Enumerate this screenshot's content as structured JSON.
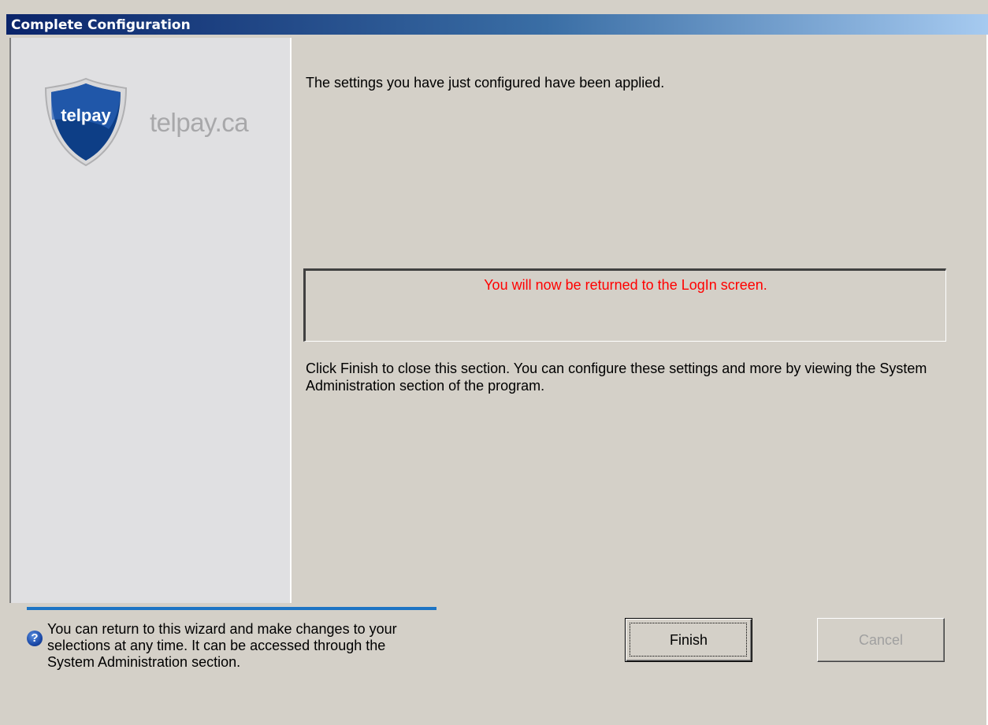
{
  "window": {
    "title": "Complete Configuration"
  },
  "sidebar": {
    "logo_text": "telpay",
    "domain": "telpay.ca"
  },
  "main": {
    "applied_message": "The settings you have just configured have been applied.",
    "notice": "You will now be returned to the LogIn screen.",
    "finish_instructions": "Click Finish to close this section.  You can configure these settings and more by viewing the System Administration section of the program."
  },
  "footer": {
    "help_icon": "question-icon",
    "help_text": "You can return to this wizard and make changes to your selections at any time.  It can be accessed through the System Administration section.",
    "finish_label": "Finish",
    "cancel_label": "Cancel"
  },
  "colors": {
    "notice_text": "#ff0000",
    "divider_accent": "#1d74c4",
    "title_gradient_start": "#0a246a",
    "title_gradient_end": "#a6caf0"
  }
}
